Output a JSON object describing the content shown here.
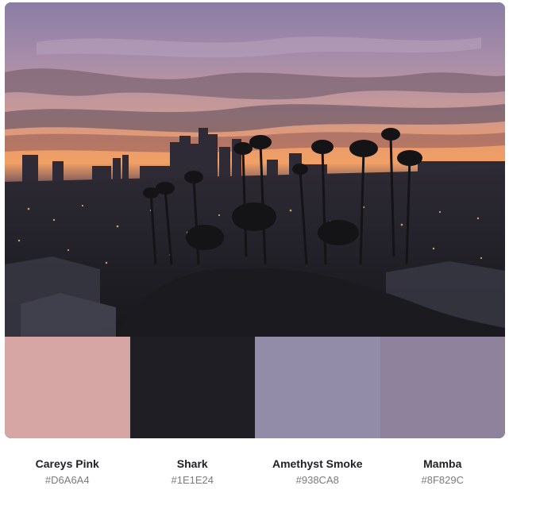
{
  "palette": [
    {
      "name": "Careys Pink",
      "hex": "#D6A6A4",
      "color": "#D6A6A4"
    },
    {
      "name": "Shark",
      "hex": "#1E1E24",
      "color": "#1E1E24"
    },
    {
      "name": "Amethyst Smoke",
      "hex": "#938CA8",
      "color": "#938CA8"
    },
    {
      "name": "Mamba",
      "hex": "#8F829C",
      "color": "#8F829C"
    }
  ],
  "photo": {
    "subject": "city skyline at sunset with palm trees silhouette"
  }
}
